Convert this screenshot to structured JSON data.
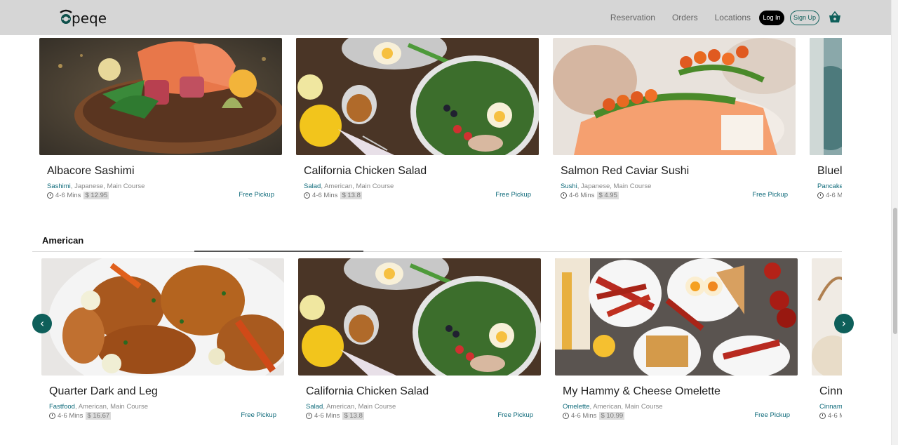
{
  "header": {
    "logo": "epeqe",
    "nav": [
      "Reservation",
      "Orders",
      "Locations"
    ],
    "login_label": "Log In",
    "signup_label": "Sign Up",
    "cart_icon": "basket-icon"
  },
  "colors": {
    "accent": "#0e5f5a",
    "header_bg": "#d6d6d6",
    "tag_link": "#0e6a7a"
  },
  "row1": {
    "cards": [
      {
        "title": "Albacore Sashimi",
        "tag_first": "Sashimi",
        "tags_rest": ", Japanese, Main Course",
        "time": "4-6 Mins",
        "price": "$ 12.95",
        "pickup": "Free Pickup",
        "image": "sashimi-plate"
      },
      {
        "title": "California Chicken Salad",
        "tag_first": "Salad",
        "tags_rest": ", American, Main Course",
        "time": "4-6 Mins",
        "price": "$ 13.8",
        "pickup": "Free Pickup",
        "image": "chicken-salad"
      },
      {
        "title": "Salmon Red Caviar Sushi",
        "tag_first": "Sushi",
        "tags_rest": ", Japanese, Main Course",
        "time": "4-6 Mins",
        "price": "$ 4.95",
        "pickup": "Free Pickup",
        "image": "caviar-sushi"
      },
      {
        "title": "Bluel",
        "tag_first": "Pancake",
        "tags_rest": "",
        "time": "4-6 M",
        "price": "",
        "pickup": "",
        "image": "pancake"
      }
    ]
  },
  "section": {
    "title": "American"
  },
  "row2": {
    "cards": [
      {
        "title": "Quarter Dark and Leg",
        "tag_first": "Fastfood",
        "tags_rest": ", American, Main Course",
        "time": "4-6 Mins",
        "price": "$ 16.67",
        "pickup": "Free Pickup",
        "image": "roast-chicken"
      },
      {
        "title": "California Chicken Salad",
        "tag_first": "Salad",
        "tags_rest": ", American, Main Course",
        "time": "4-6 Mins",
        "price": "$ 13.8",
        "pickup": "Free Pickup",
        "image": "chicken-salad"
      },
      {
        "title": "My Hammy & Cheese Omelette",
        "tag_first": "Omelette",
        "tags_rest": ", American, Main Course",
        "time": "4-6 Mins",
        "price": "$ 10.99",
        "pickup": "Free Pickup",
        "image": "breakfast-spread"
      },
      {
        "title": "Cinn",
        "tag_first": "Cinnam",
        "tags_rest": "",
        "time": "4-6 M",
        "price": "",
        "pickup": "",
        "image": "cinnamon"
      }
    ]
  },
  "arrows": {
    "left": "‹",
    "right": "›"
  }
}
